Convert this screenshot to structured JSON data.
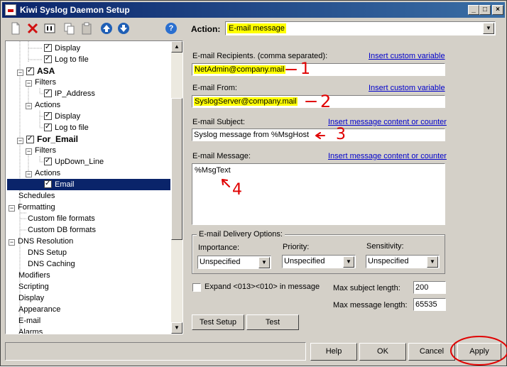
{
  "window": {
    "title": "Kiwi Syslog Daemon Setup"
  },
  "title_buttons": {
    "minimize": "_",
    "maximize": "□",
    "close": "×"
  },
  "toolbar": {
    "icons": [
      "new-icon",
      "delete-icon",
      "rename-icon",
      "copy-icon",
      "paste-icon",
      "move-up-icon",
      "move-down-icon",
      "help-icon"
    ],
    "help_glyph": "?",
    "action_label": "Action:",
    "action_value": "E-mail message"
  },
  "tree": {
    "items": [
      {
        "label": "Display",
        "checked": true,
        "selected": false
      },
      {
        "label": "Log to file",
        "checked": true,
        "selected": false
      },
      {
        "label": "ASA",
        "checked": true,
        "expanded": true,
        "bold": true
      },
      {
        "label": "Filters",
        "expanded": true
      },
      {
        "label": "IP_Address",
        "checked": true
      },
      {
        "label": "Actions",
        "expanded": true
      },
      {
        "label": "Display",
        "checked": true
      },
      {
        "label": "Log to file",
        "checked": true
      },
      {
        "label": "For_Email",
        "checked": true,
        "expanded": true,
        "bold": true
      },
      {
        "label": "Filters",
        "expanded": true
      },
      {
        "label": "UpDown_Line",
        "checked": true
      },
      {
        "label": "Actions",
        "expanded": true
      },
      {
        "label": "Email",
        "checked": true,
        "selected": true
      },
      {
        "label": "Schedules"
      },
      {
        "label": "Formatting",
        "expanded": true
      },
      {
        "label": "Custom file formats"
      },
      {
        "label": "Custom DB formats"
      },
      {
        "label": "DNS Resolution",
        "expanded": true
      },
      {
        "label": "DNS Setup"
      },
      {
        "label": "DNS Caching"
      },
      {
        "label": "Modifiers"
      },
      {
        "label": "Scripting"
      },
      {
        "label": "Display"
      },
      {
        "label": "Appearance"
      },
      {
        "label": "E-mail"
      },
      {
        "label": "Alarms"
      }
    ]
  },
  "email": {
    "recipients_label": "E-mail Recipients. (comma separated):",
    "recipients_link": "Insert custom variable",
    "recipients_value": "NetAdmin@company.mail",
    "from_label": "E-mail From:",
    "from_link": "Insert custom variable",
    "from_value": "SyslogServer@company.mail",
    "subject_label": "E-mail Subject:",
    "subject_link": "Insert message content or counter",
    "subject_value": "Syslog message from %MsgHost",
    "message_label": "E-mail Message:",
    "message_link": "Insert message content or counter",
    "message_value": "%MsgText"
  },
  "delivery": {
    "group_title": "E-mail Delivery Options:",
    "importance_label": "Importance:",
    "importance_value": "Unspecified",
    "priority_label": "Priority:",
    "priority_value": "Unspecified",
    "sensitivity_label": "Sensitivity:",
    "sensitivity_value": "Unspecified"
  },
  "options": {
    "expand_label": "Expand <013><010> in message",
    "expand_checked": false,
    "max_subject_label": "Max subject length:",
    "max_subject_value": "200",
    "max_message_label": "Max message length:",
    "max_message_value": "65535"
  },
  "buttons": {
    "test_setup": "Test Setup",
    "test": "Test",
    "help": "Help",
    "ok": "OK",
    "cancel": "Cancel",
    "apply": "Apply"
  },
  "annotations": {
    "n1": "1",
    "n2": "2",
    "n3": "3",
    "n4": "4",
    "color": "#e00000"
  }
}
